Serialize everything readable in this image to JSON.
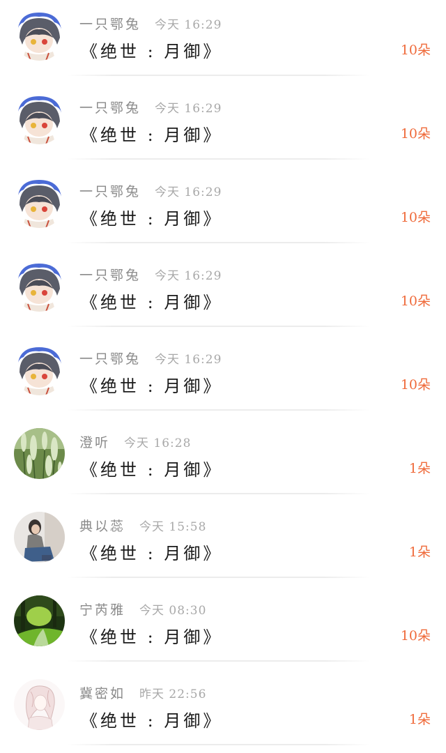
{
  "items": [
    {
      "name": "一只鄂兔",
      "time": "今天  16:29",
      "title": "《绝世 : 月御》",
      "count": "10朵",
      "avatar": "anime-girl"
    },
    {
      "name": "一只鄂兔",
      "time": "今天  16:29",
      "title": "《绝世 : 月御》",
      "count": "10朵",
      "avatar": "anime-girl"
    },
    {
      "name": "一只鄂兔",
      "time": "今天  16:29",
      "title": "《绝世 : 月御》",
      "count": "10朵",
      "avatar": "anime-girl"
    },
    {
      "name": "一只鄂兔",
      "time": "今天  16:29",
      "title": "《绝世 : 月御》",
      "count": "10朵",
      "avatar": "anime-girl"
    },
    {
      "name": "一只鄂兔",
      "time": "今天  16:29",
      "title": "《绝世 : 月御》",
      "count": "10朵",
      "avatar": "anime-girl"
    },
    {
      "name": "澄听",
      "time": "今天  16:28",
      "title": "《绝世 : 月御》",
      "count": "1朵",
      "avatar": "green-plant"
    },
    {
      "name": "典以蕊",
      "time": "今天  15:58",
      "title": "《绝世 : 月御》",
      "count": "1朵",
      "avatar": "sitting-person"
    },
    {
      "name": "宁芮雅",
      "time": "今天  08:30",
      "title": "《绝世 : 月御》",
      "count": "10朵",
      "avatar": "forest-path"
    },
    {
      "name": "冀密如",
      "time": "昨天  22:56",
      "title": "《绝世 : 月御》",
      "count": "1朵",
      "avatar": "sketch-girl"
    }
  ],
  "colors": {
    "name": "#8a8a8a",
    "time": "#a8a8a8",
    "title": "#1a1a1a",
    "count": "#ef6a3a"
  }
}
